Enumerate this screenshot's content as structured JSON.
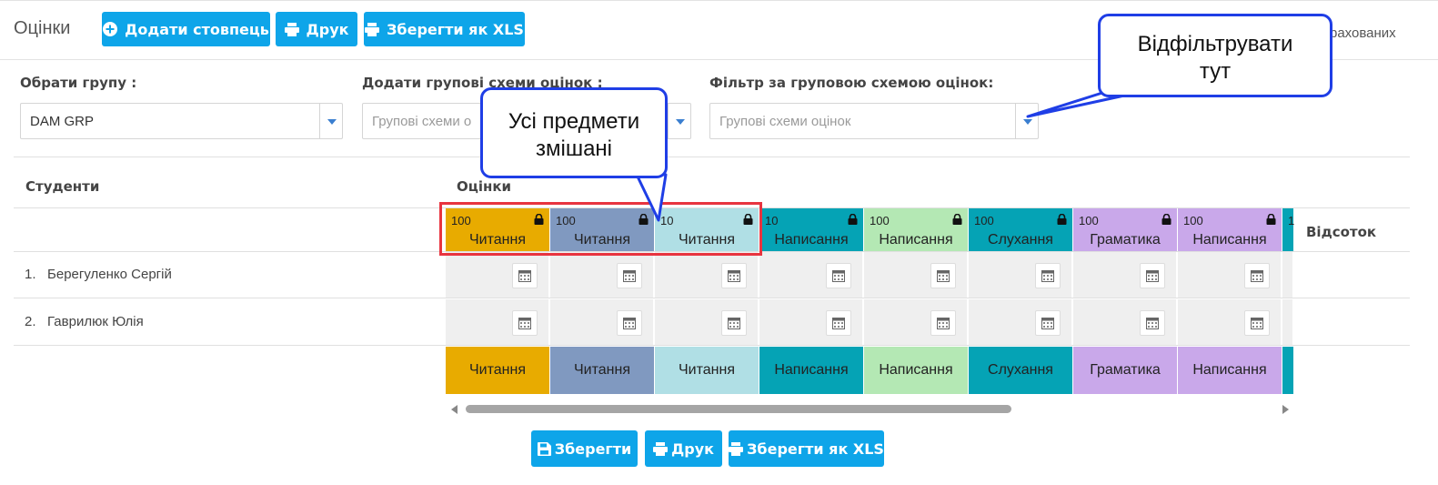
{
  "header": {
    "title": "Оцінки",
    "add_column_label": "Додати стовпець",
    "print_label": "Друк",
    "save_xls_label": "Зберегти як XLS",
    "right_text": "рахованих"
  },
  "filters": {
    "group_label": "Обрати групу :",
    "group_value": "DAM GRP",
    "add_schemes_label": "Додати групові схеми оцінок :",
    "add_schemes_placeholder": "Групові схеми о",
    "filter_label": "Фільтр за груповою схемою оцінок:",
    "filter_placeholder": "Групові схеми оцінок"
  },
  "table": {
    "students_header": "Студенти",
    "grades_header": "Оцінки",
    "percent_header": "Відсоток",
    "columns": [
      {
        "points": "100",
        "name": "Читання",
        "color": "#e8ab00"
      },
      {
        "points": "100",
        "name": "Читання",
        "color": "#8099c0"
      },
      {
        "points": "10",
        "name": "Читання",
        "color": "#b0dfe5"
      },
      {
        "points": "10",
        "name": "Написання",
        "color": "#05a3b5"
      },
      {
        "points": "100",
        "name": "Написання",
        "color": "#b4e8b4"
      },
      {
        "points": "100",
        "name": "Слухання",
        "color": "#05a3b5"
      },
      {
        "points": "100",
        "name": "Граматика",
        "color": "#c9a8ea"
      },
      {
        "points": "100",
        "name": "Написання",
        "color": "#c9a8ea"
      },
      {
        "points": "1",
        "name": "",
        "color": "#05a3b5"
      }
    ],
    "students": [
      {
        "num": "1.",
        "name": "Берегуленко Сергій"
      },
      {
        "num": "2.",
        "name": "Гаврилюк Юлія"
      }
    ]
  },
  "footer": {
    "save_label": "Зберегти",
    "print_label": "Друк",
    "save_xls_label": "Зберегти як XLS"
  },
  "annotations": {
    "callout_filter": "Відфільтрувати тут",
    "callout_mixed": "Усі предмети змішані"
  },
  "colors": {
    "accent": "#0ea5e9",
    "highlight_border": "#e8343f",
    "callout_border": "#1f3ee6"
  }
}
